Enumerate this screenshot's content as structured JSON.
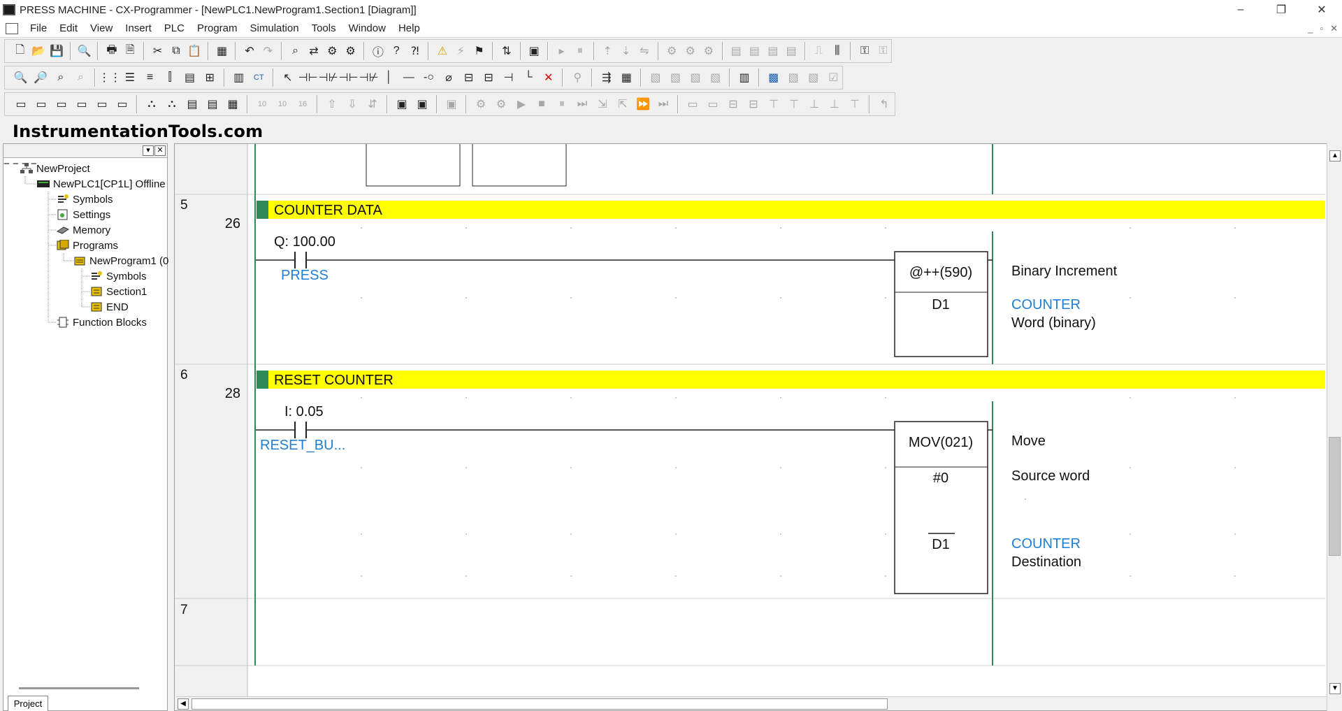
{
  "window": {
    "title": "PRESS MACHINE - CX-Programmer - [NewPLC1.NewProgram1.Section1 [Diagram]]",
    "controls": [
      "–",
      "❐",
      "✕"
    ]
  },
  "menu": [
    "File",
    "Edit",
    "View",
    "Insert",
    "PLC",
    "Program",
    "Simulation",
    "Tools",
    "Window",
    "Help"
  ],
  "mdi_controls": [
    "_",
    "▫",
    "✕"
  ],
  "watermark": "InstrumentationTools.com",
  "project_tree": {
    "tab_label": "Project",
    "nodes": [
      {
        "label": "NewProject",
        "icon": "project-icon"
      },
      {
        "label": "NewPLC1[CP1L] Offline",
        "icon": "plc-icon"
      },
      {
        "label": "Symbols",
        "icon": "symbols-icon"
      },
      {
        "label": "Settings",
        "icon": "settings-icon"
      },
      {
        "label": "Memory",
        "icon": "memory-icon"
      },
      {
        "label": "Programs",
        "icon": "programs-icon"
      },
      {
        "label": "NewProgram1 (0",
        "icon": "program-icon"
      },
      {
        "label": "Symbols",
        "icon": "symbols-icon"
      },
      {
        "label": "Section1",
        "icon": "section-icon"
      },
      {
        "label": "END",
        "icon": "section-icon"
      },
      {
        "label": "Function Blocks",
        "icon": "function-blocks-icon"
      }
    ]
  },
  "ladder": {
    "colors": {
      "comment_bar": "#ffff00",
      "symbol_blue": "#1e7fd6",
      "rail_green": "#2e8b57"
    },
    "rungs": [
      {
        "rung_number": "5",
        "step": "26",
        "comment": "COUNTER DATA",
        "contact_address": "Q: 100.00",
        "contact_symbol": "PRESS",
        "instruction": "@++(590)",
        "instruction_desc": "Binary Increment",
        "operands": [
          {
            "value": "D1",
            "symbol": "COUNTER",
            "desc": "Word (binary)"
          }
        ]
      },
      {
        "rung_number": "6",
        "step": "28",
        "comment": "RESET COUNTER",
        "contact_address": "I: 0.05",
        "contact_symbol": "RESET_BU...",
        "instruction": "MOV(021)",
        "instruction_desc": "Move",
        "operands": [
          {
            "value": "#0",
            "symbol": "",
            "desc": "Source word"
          },
          {
            "value": "D1",
            "symbol": "COUNTER",
            "desc": "Destination"
          }
        ]
      },
      {
        "rung_number": "7",
        "step": ""
      }
    ]
  }
}
